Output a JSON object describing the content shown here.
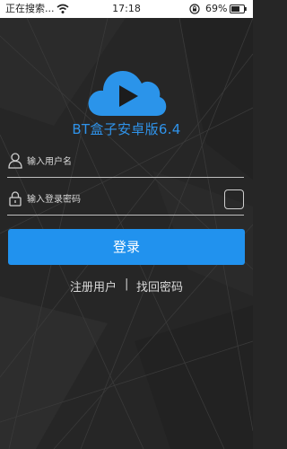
{
  "status_bar": {
    "carrier_text": "正在搜索...",
    "time": "17:18",
    "battery_percent": "69%"
  },
  "app": {
    "title": "BT盒子安卓版6.4",
    "accent_color": "#2192ee",
    "logo_icon": "cloud-play-icon"
  },
  "login_form": {
    "username_placeholder": "输入用户名",
    "password_placeholder": "输入登录密码",
    "login_button_label": "登录",
    "register_link": "注册用户",
    "separator": "|",
    "forgot_password_link": "找回密码"
  }
}
